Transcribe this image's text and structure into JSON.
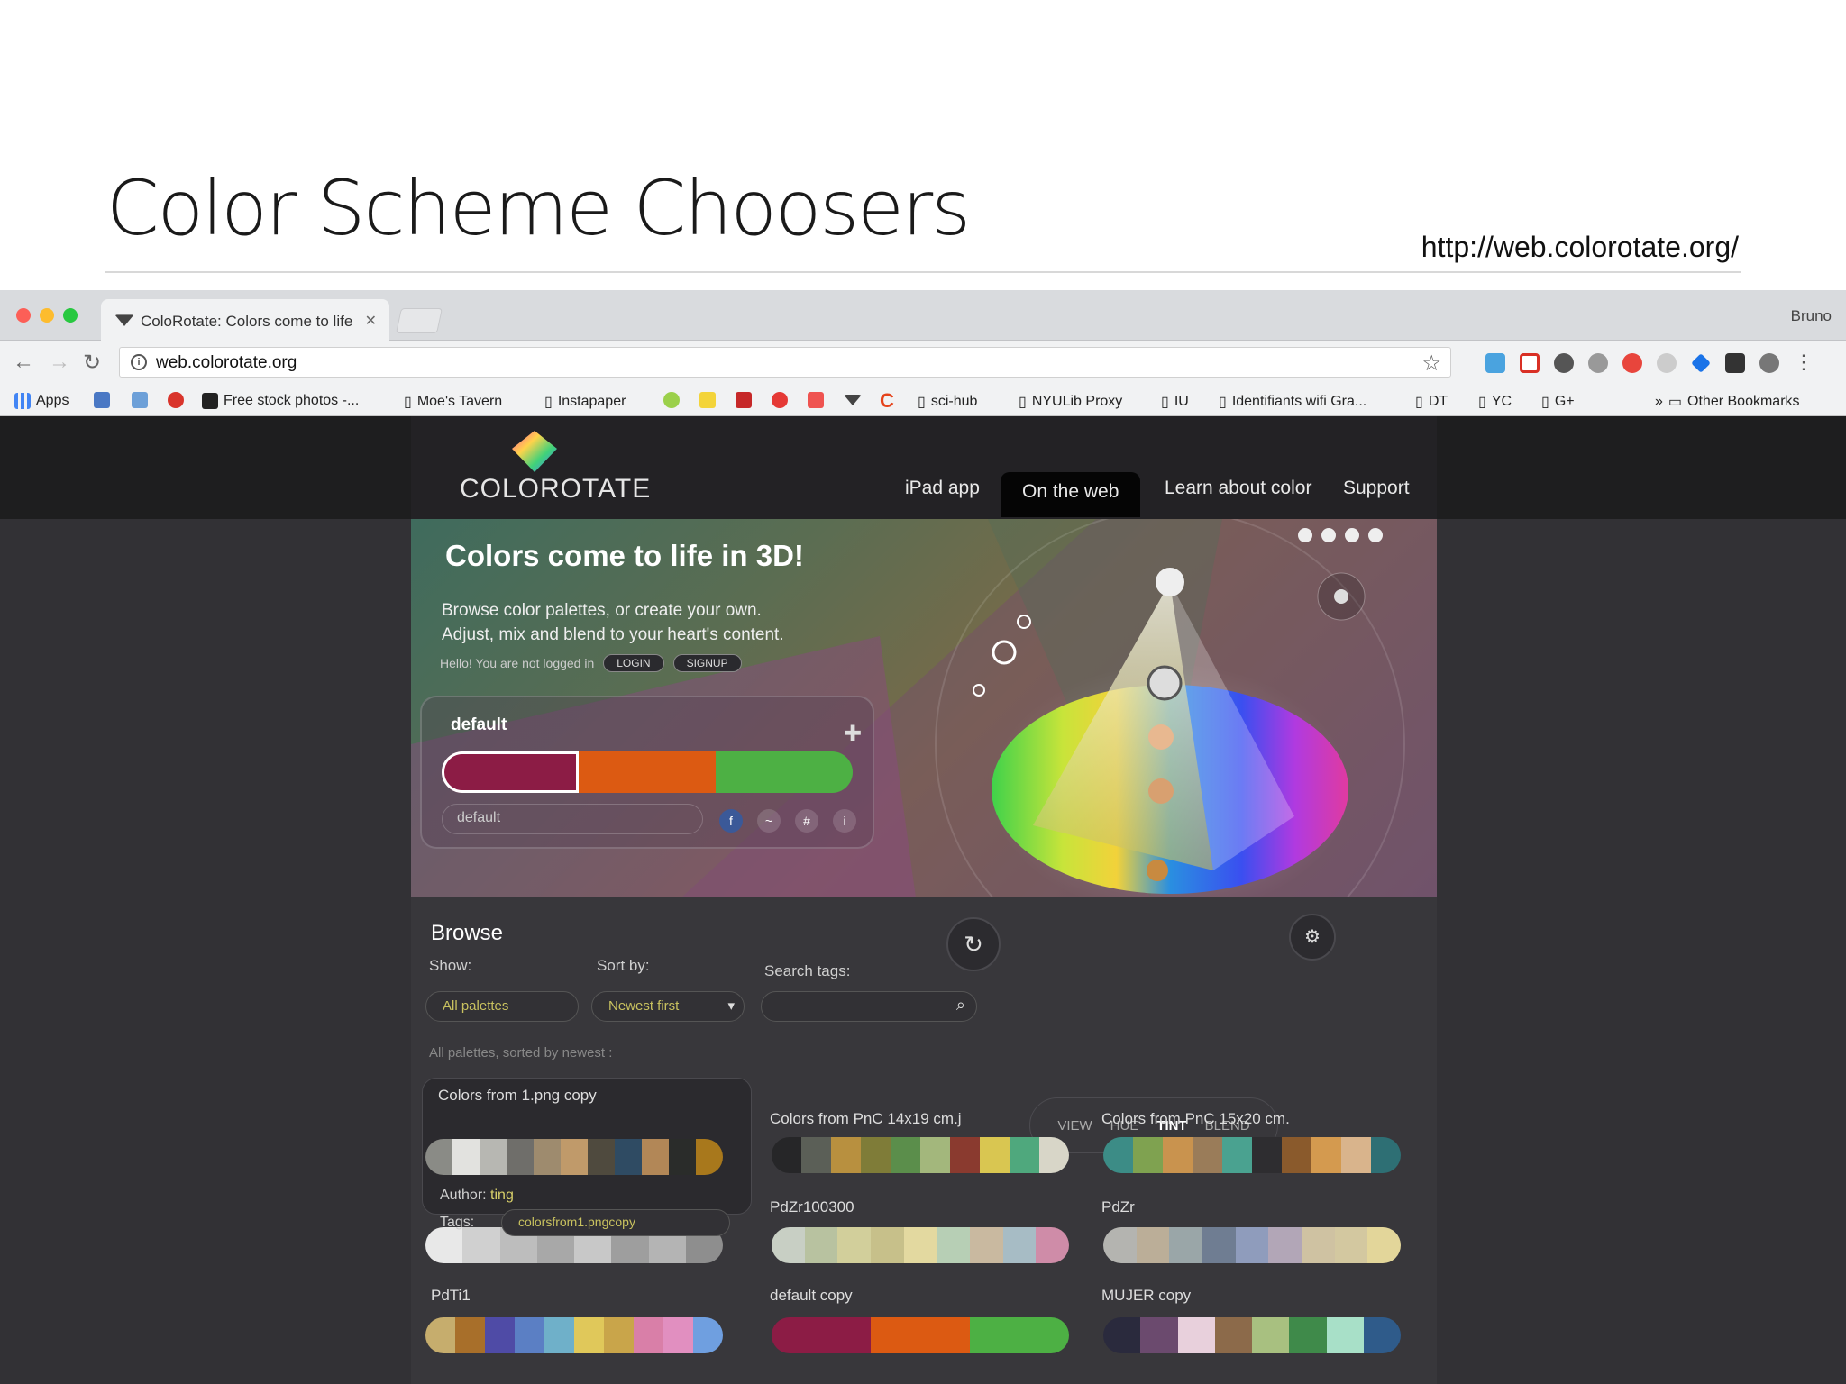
{
  "slide": {
    "title": "Color Scheme Choosers",
    "url": "http://web.colorotate.org/"
  },
  "browser": {
    "tab_title": "ColoRotate: Colors come to life",
    "user": "Bruno",
    "address": "web.colorotate.org",
    "bookmarks": [
      "Apps",
      "Free stock photos -...",
      "Moe's Tavern",
      "Instapaper",
      "sci-hub",
      "NYULib Proxy",
      "IU",
      "Identifiants wifi Gra...",
      "DT",
      "YC",
      "G+",
      "Other Bookmarks"
    ]
  },
  "site": {
    "logo": "COLOROTATE",
    "nav": [
      "iPad app",
      "On the web",
      "Learn about color",
      "Support"
    ],
    "hero_title": "Colors come to life in 3D!",
    "hero_line1": "Browse color palettes, or create your own.",
    "hero_line2": "Adjust, mix and blend to your heart's content.",
    "hello": "Hello! You are not logged in",
    "login": "LOGIN",
    "signup": "SIGNUP",
    "palette_name": "default",
    "palette_input": "default",
    "palette_colors": [
      "#8c1c45",
      "#dc5a12",
      "#4db044"
    ],
    "browse": "Browse",
    "show_label": "Show:",
    "show_value": "All palettes",
    "sort_label": "Sort by:",
    "sort_value": "Newest first",
    "search_label": "Search tags:",
    "modes": [
      "VIEW",
      "HUE",
      "TINT",
      "BLEND"
    ],
    "sorted_text": "All palettes, sorted by newest :",
    "author_label": "Author:",
    "author": "ting",
    "tags_label": "Tags:",
    "tags": "colorsfrom1.pngcopy",
    "cards": [
      {
        "title": "Colors from 1.png copy",
        "colors": [
          "#8a8b86",
          "#e2e2df",
          "#b7b7b2",
          "#6f6e6a",
          "#9e8b6e",
          "#c09a6a",
          "#4f4a3e",
          "#2f4b63",
          "#b28757",
          "#2a2c2a",
          "#a8781c"
        ]
      },
      {
        "title": "Colors from PnC 14x19 cm.j",
        "colors": [
          "#262628",
          "#5b5f57",
          "#b8903f",
          "#7f7c38",
          "#5b8e4b",
          "#a3b77c",
          "#8a3a2f",
          "#d9c651",
          "#4fa87d",
          "#d8d6c8"
        ]
      },
      {
        "title": "Colors from PnC 15x20 cm.",
        "colors": [
          "#3c8c86",
          "#7fa250",
          "#c9934e",
          "#9a7c59",
          "#4aa290",
          "#2e2d30",
          "#8a5a2c",
          "#d49a4f",
          "#d9b48c",
          "#2e6f74"
        ]
      },
      {
        "title": "",
        "colors": [
          "#e8e8e8",
          "#d0d0d0",
          "#bdbdbd",
          "#a8a8a8",
          "#c8c8c8",
          "#9e9e9e",
          "#b4b4b4",
          "#8e8e8e"
        ]
      },
      {
        "title": "PdZr100300",
        "colors": [
          "#c8cfc4",
          "#b8c2a0",
          "#d2cf9b",
          "#c7c08a",
          "#e3d9a0",
          "#b7cfb5",
          "#c9b9a0",
          "#a7bcc5",
          "#cf8ca8"
        ]
      },
      {
        "title": "PdZr",
        "colors": [
          "#b4b4b0",
          "#bbae98",
          "#9aa6a8",
          "#6f7d92",
          "#8f9cbc",
          "#b2a6b7",
          "#cfc2a2",
          "#d3c8a0",
          "#e3d69a"
        ]
      },
      {
        "title": "PdTi1",
        "colors": [
          "#c6ad6d",
          "#a86f2a",
          "#4f4ba6",
          "#5b7fc4",
          "#6fb0c9",
          "#e0c85a",
          "#c9a54a",
          "#d97fa8",
          "#e18fc0",
          "#6f9fe0"
        ]
      },
      {
        "title": "default copy",
        "colors": [
          "#8c1c45",
          "#dc5a12",
          "#4db044"
        ]
      },
      {
        "title": "MUJER copy",
        "colors": [
          "#2a2a3d",
          "#6b4a6e",
          "#e8d0dc",
          "#8c6a4a",
          "#a8c080",
          "#3f8a4a",
          "#a8e0c8",
          "#2f5b8a"
        ]
      }
    ]
  }
}
